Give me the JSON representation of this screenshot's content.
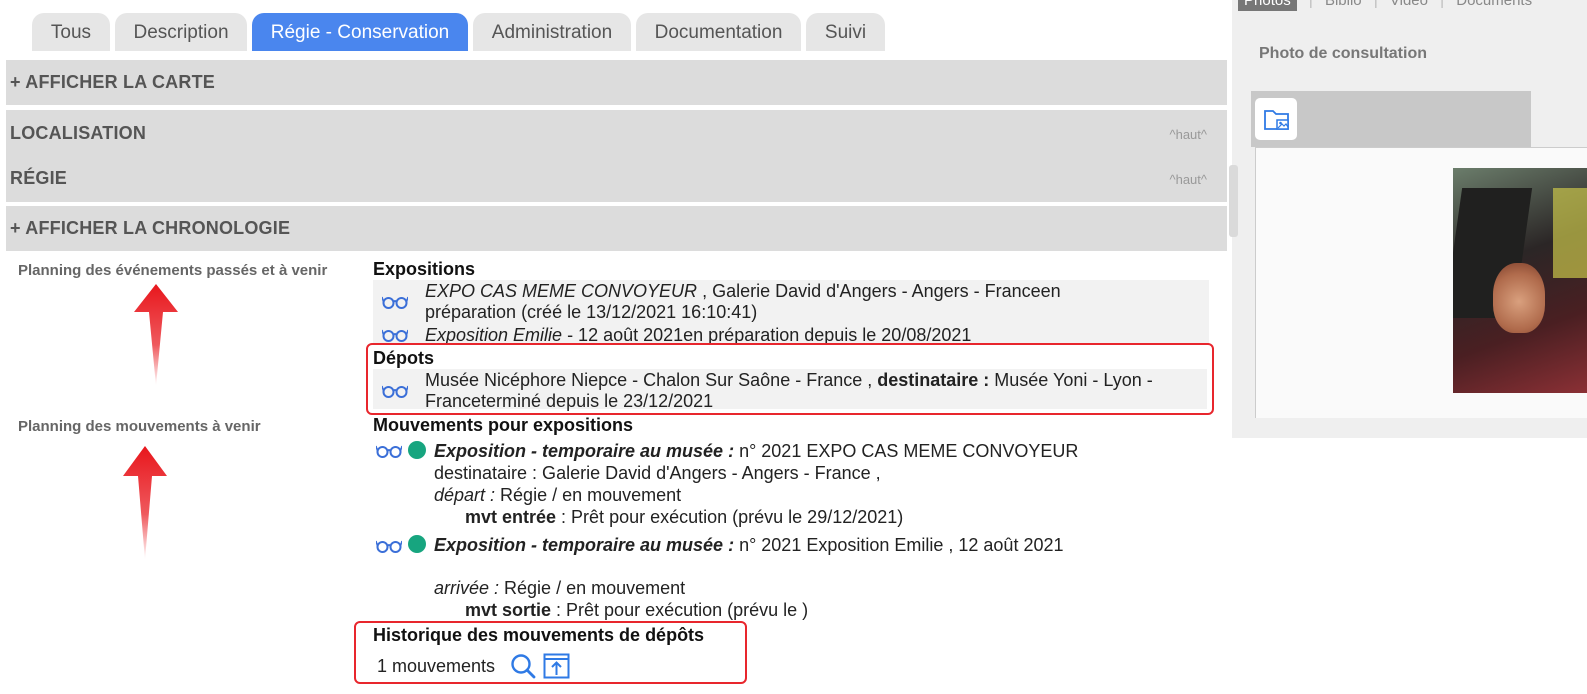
{
  "tabs": [
    {
      "label": "Tous",
      "active": false
    },
    {
      "label": "Description",
      "active": false
    },
    {
      "label": "Régie - Conservation",
      "active": true
    },
    {
      "label": "Administration",
      "active": false
    },
    {
      "label": "Documentation",
      "active": false
    },
    {
      "label": "Suivi",
      "active": false
    }
  ],
  "sections": {
    "carte": "+ AFFICHER LA CARTE",
    "localisation": "LOCALISATION",
    "regie": "RÉGIE",
    "chronologie": "+ AFFICHER LA CHRONOLOGIE",
    "haut": "^haut^"
  },
  "side_labels": {
    "events": "Planning des événements passés et à venir",
    "movements": "Planning des mouvements à venir"
  },
  "expositions": {
    "heading": "Expositions",
    "item1_title": "EXPO CAS MEME CONVOYEUR",
    "item1_rest": " ,  Galerie David d'Angers - Angers - Franceen",
    "item1_line2": "préparation (créé le 13/12/2021 16:10:41)",
    "item2_title": "Exposition Emilie",
    "item2_rest": " - 12 août 2021en préparation depuis le 20/08/2021"
  },
  "depots": {
    "heading": "Dépots",
    "line1_a": "Musée Nicéphore Niepce - Chalon Sur Saône - France , ",
    "line1_b": "destinataire :",
    "line1_c": " Musée Yoni - Lyon -",
    "line2": "Franceterminé depuis le 23/12/2021"
  },
  "mouvements": {
    "heading": "Mouvements pour expositions",
    "m1_type": "Exposition - temporaire au musée :",
    "m1_rest": " n° 2021 EXPO CAS MEME CONVOYEUR",
    "m1_dest": "destinataire : Galerie David d'Angers - Angers - France ,",
    "m1_dep_label": "départ :",
    "m1_dep_val": " Régie / en mouvement",
    "m1_mvt_label": "mvt entrée",
    "m1_mvt_val": " : Prêt pour exécution (prévu le 29/12/2021)",
    "m2_type": "Exposition - temporaire au musée :",
    "m2_rest": " n° 2021 Exposition Emilie , 12 août 2021",
    "m2_arr_label": "arrivée :",
    "m2_arr_val": " Régie / en mouvement",
    "m2_mvt_label": "mvt sortie",
    "m2_mvt_val": " : Prêt pour exécution (prévu le )"
  },
  "historique": {
    "heading": "Historique des mouvements de dépôts",
    "count_text": "1 mouvements"
  },
  "right_panel": {
    "tabs": [
      "Photos",
      "Biblio",
      "Video",
      "Documents"
    ],
    "title": "Photo de consultation"
  },
  "colors": {
    "accent": "#4a86ee",
    "bar": "#dcdcdc",
    "status_green": "#17a57f",
    "highlight_red": "#e8262d"
  },
  "icons": [
    "glasses-icon",
    "status-dot-icon",
    "search-icon",
    "export-icon",
    "folder-image-icon",
    "arrow-up-icon"
  ]
}
